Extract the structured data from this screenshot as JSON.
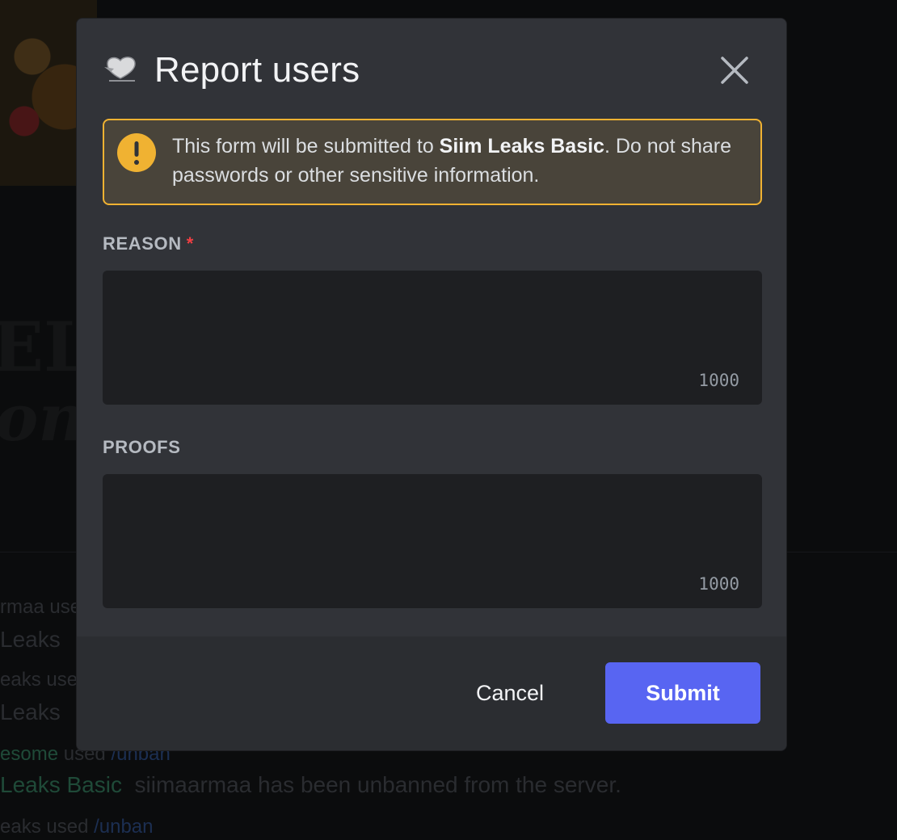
{
  "background": {
    "messages": [
      {
        "prefix": "rmaa",
        "mid": " use",
        "cmd": ""
      },
      {
        "bot": "Leaks"
      },
      {
        "prefix": "eaks",
        "mid": " use",
        "cmd": ""
      },
      {
        "bot": "Leaks"
      },
      {
        "prefix": "esome",
        "mid": " used ",
        "cmd": "/unban"
      },
      {
        "bot": "Leaks Basic",
        "text": "siimaarmaa has been unbanned from the server."
      },
      {
        "prefix": "eaks",
        "mid": " used ",
        "cmd": "/unban"
      }
    ]
  },
  "modal": {
    "title": "Report users",
    "app_icon": "heart-app-icon",
    "close_icon": "close-icon",
    "warning": {
      "icon": "exclamation-circle-icon",
      "text_before": "This form will be submitted to ",
      "server_name": "Siim Leaks Basic",
      "text_after": ". Do not share passwords or other sensitive information."
    },
    "fields": [
      {
        "label": "REASON",
        "required_mark": "*",
        "value": "",
        "counter": "1000"
      },
      {
        "label": "PROOFS",
        "value": "",
        "counter": "1000"
      }
    ],
    "footer": {
      "cancel_label": "Cancel",
      "submit_label": "Submit"
    }
  },
  "colors": {
    "accent": "#5865f2",
    "warning_border": "#f0b232",
    "required": "#f23f43"
  }
}
